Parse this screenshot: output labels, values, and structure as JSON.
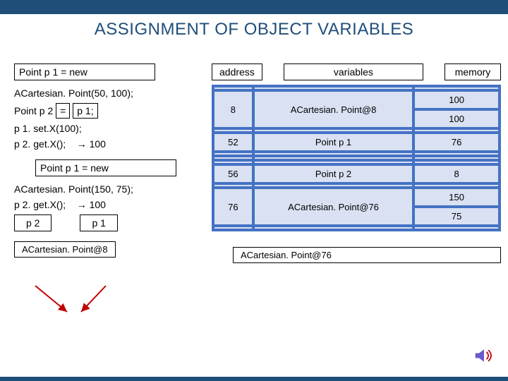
{
  "title": "ASSIGNMENT OF OBJECT VARIABLES",
  "left": {
    "line1": "Point p 1  = new",
    "line2": "ACartesian. Point(50, 100);",
    "line3_a": "Point p 2",
    "line3_b": "=",
    "line3_c": "p 1;",
    "line4": "p 1. set.X(100);",
    "line5_a": "p 2. get.X();",
    "line5_b": "→ 100",
    "line6": "Point p 1  = new",
    "line7": "ACartesian. Point(150, 75);",
    "line8_a": "p 2. get.X();",
    "line8_b": "→ 100",
    "p2": "p 2",
    "p1": "p 1",
    "obj8": "ACartesian. Point@8",
    "obj76": "ACartesian. Point@76"
  },
  "headers": {
    "address": "address",
    "variables": "variables",
    "memory": "memory"
  },
  "rows": [
    {
      "addr": "8",
      "var": "ACartesian. Point@8",
      "mem1": "100",
      "mem2": "100"
    },
    {
      "addr": "52",
      "var": "Point p 1",
      "mem1": "76",
      "mem2": ""
    },
    {
      "addr": "56",
      "var": "Point p 2",
      "mem1": "8",
      "mem2": ""
    },
    {
      "addr": "76",
      "var": "ACartesian. Point@76",
      "mem1": "150",
      "mem2": "75"
    }
  ],
  "chart_data": {
    "type": "table",
    "title": "Memory model of object variable assignment",
    "columns": [
      "address",
      "variables",
      "memory"
    ],
    "rows": [
      [
        "8",
        "ACartesian.Point@8",
        [
          100,
          100
        ]
      ],
      [
        "52",
        "Point p1",
        [
          76
        ]
      ],
      [
        "56",
        "Point p2",
        [
          8
        ]
      ],
      [
        "76",
        "ACartesian.Point@76",
        [
          150,
          75
        ]
      ]
    ]
  }
}
